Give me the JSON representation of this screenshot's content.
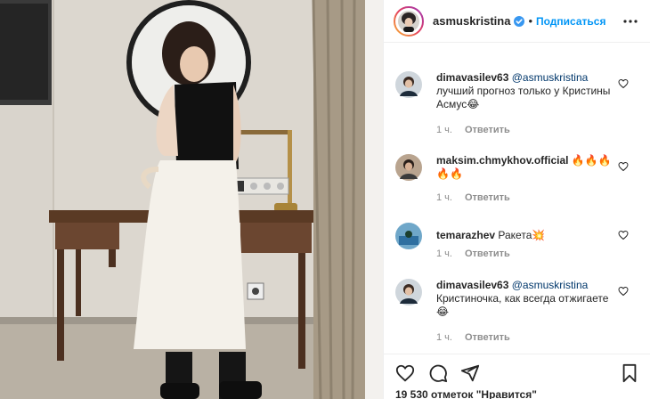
{
  "post": {
    "author": "asmuskristina",
    "separator": "•",
    "follow_label": "Подписаться",
    "likes_text": "19 530 отметок \"Нравится\""
  },
  "comments": [
    {
      "user": "dimavasilev63",
      "mention": "@asmuskristina",
      "text": "лучший прогноз только у Кристины Асмус😂",
      "time": "1 ч.",
      "reply": "Ответить"
    },
    {
      "user": "maksim.chmykhov.official",
      "mention": "",
      "text": "🔥🔥🔥🔥🔥",
      "time": "1 ч.",
      "reply": "Ответить"
    },
    {
      "user": "temarazhev",
      "mention": "",
      "text": "Ракета💥",
      "time": "1 ч.",
      "reply": "Ответить"
    },
    {
      "user": "dimavasilev63",
      "mention": "@asmuskristina",
      "text": "Кристиночка, как всегда отжигаете😂",
      "time": "1 ч.",
      "reply": "Ответить"
    }
  ],
  "icons": {
    "header": [
      "verified-icon",
      "more-options-icon"
    ],
    "comment": [
      "heart-outline-icon"
    ],
    "actions": [
      "heart-icon",
      "comment-icon",
      "share-icon",
      "bookmark-icon"
    ]
  },
  "colors": {
    "follow": "#0095f6",
    "verified": "#3897f0",
    "mention": "#00376b",
    "muted": "#8e8e8e"
  }
}
